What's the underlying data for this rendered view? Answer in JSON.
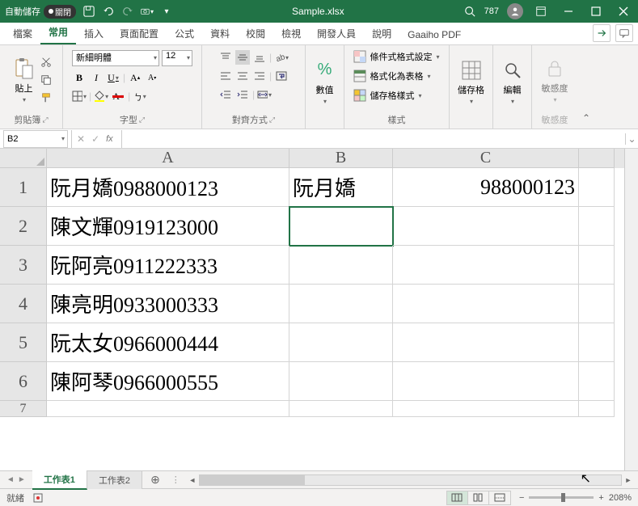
{
  "titlebar": {
    "autosave_label": "自動儲存",
    "autosave_state": "關閉",
    "filename": "Sample.xlsx",
    "user_label": "787"
  },
  "tabs": {
    "file": "檔案",
    "home": "常用",
    "insert": "插入",
    "layout": "頁面配置",
    "formulas": "公式",
    "data": "資料",
    "review": "校閱",
    "view": "檢視",
    "developer": "開發人員",
    "help": "說明",
    "pdf": "Gaaiho PDF"
  },
  "ribbon": {
    "clipboard": {
      "label": "剪貼簿",
      "paste": "貼上"
    },
    "font": {
      "label": "字型",
      "name": "新細明體",
      "size": "12"
    },
    "align": {
      "label": "對齊方式"
    },
    "number": {
      "label": "數值"
    },
    "styles": {
      "label": "樣式",
      "cond": "條件式格式設定",
      "table": "格式化為表格",
      "cell": "儲存格樣式"
    },
    "cells": {
      "label": "儲存格"
    },
    "editing": {
      "label": "編輯"
    },
    "sensitivity": {
      "label": "敏感度",
      "btn": "敏感度"
    }
  },
  "formula_bar": {
    "name": "B2",
    "formula": ""
  },
  "columns": {
    "a": "A",
    "b": "B",
    "c": "C"
  },
  "rows": {
    "1": {
      "a": "阮月嬌0988000123",
      "b": "阮月嬌",
      "c": "988000123"
    },
    "2": {
      "a": "陳文輝0919123000",
      "b": "",
      "c": ""
    },
    "3": {
      "a": "阮阿亮0911222333",
      "b": "",
      "c": ""
    },
    "4": {
      "a": "陳亮明0933000333",
      "b": "",
      "c": ""
    },
    "5": {
      "a": "阮太女0966000444",
      "b": "",
      "c": ""
    },
    "6": {
      "a": "陳阿琴0966000555",
      "b": "",
      "c": ""
    },
    "7": {
      "a": "",
      "b": "",
      "c": ""
    }
  },
  "sheet_tabs": {
    "s1": "工作表1",
    "s2": "工作表2"
  },
  "statusbar": {
    "ready": "就緒",
    "zoom": "208%"
  }
}
